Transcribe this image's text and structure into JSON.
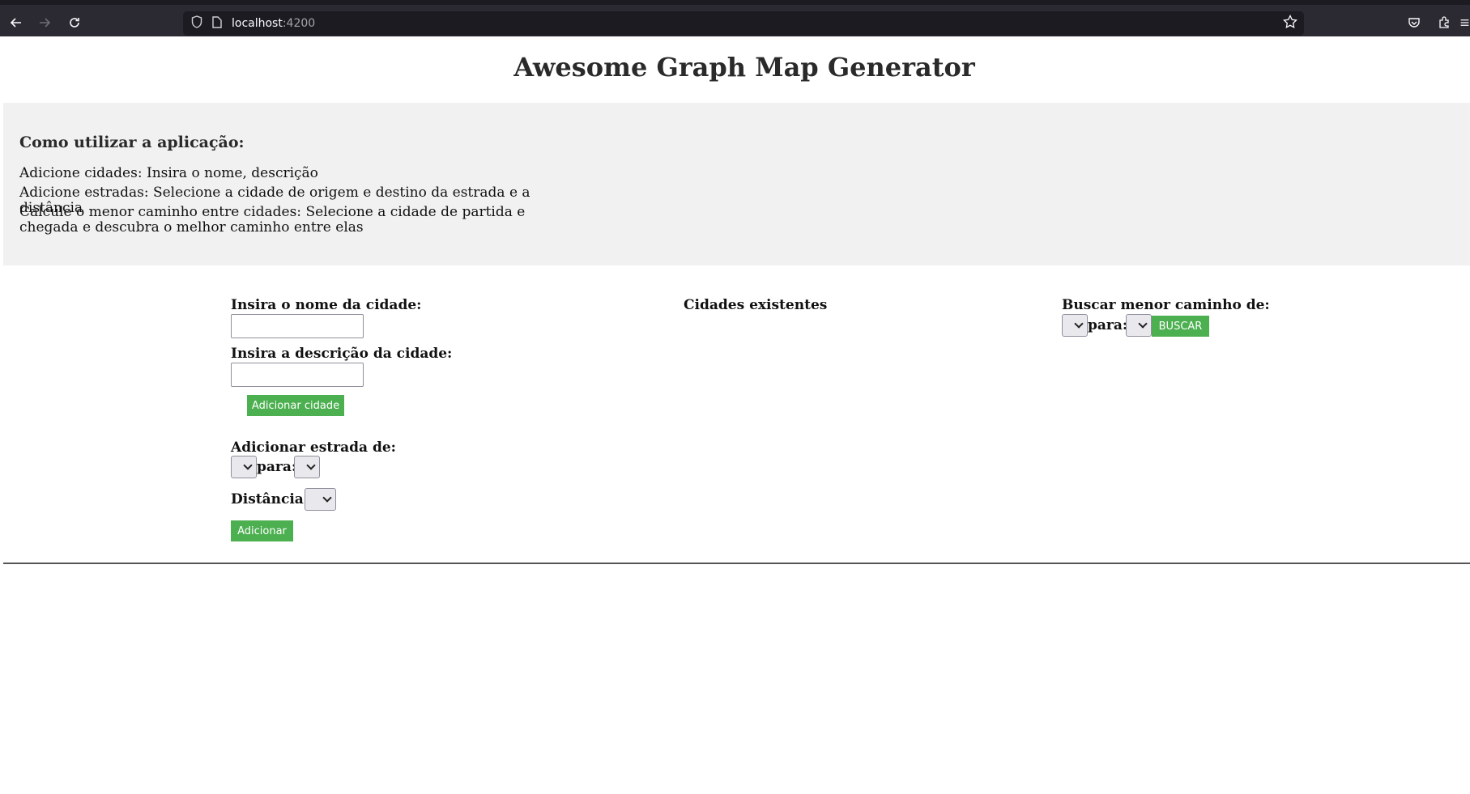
{
  "browser": {
    "url_host": "localhost",
    "url_port": ":4200",
    "icons": [
      "back-arrow-icon",
      "forward-arrow-icon",
      "reload-icon",
      "shield-icon",
      "page-icon",
      "star-icon",
      "pocket-icon",
      "extensions-icon",
      "menu-icon"
    ]
  },
  "page": {
    "title": "Awesome Graph Map Generator"
  },
  "instructions": {
    "heading": "Como utilizar a aplicação:",
    "items": [
      "Adicione cidades: Insira o nome, descrição",
      "Adicione estradas: Selecione a cidade de origem e destino da estrada e a distância",
      "Calcule o menor caminho entre cidades: Selecione a cidade de partida e chegada e descubra o melhor caminho entre elas"
    ]
  },
  "city_form": {
    "name_label": "Insira o nome da cidade:",
    "name_value": "",
    "description_label": "Insira a descrição da cidade:",
    "description_value": "",
    "add_button": "Adicionar cidade"
  },
  "road_form": {
    "from_label": "Adicionar estrada de:",
    "to_label": "para:",
    "distance_label": "Distância:",
    "from_value": "",
    "to_value": "",
    "distance_value": "",
    "add_button": "Adicionar"
  },
  "cities": {
    "heading": "Cidades existentes",
    "items": []
  },
  "shortest_path": {
    "from_label": "Buscar menor caminho de:",
    "to_label": "para:",
    "from_value": "",
    "to_value": "",
    "search_button": "BUSCAR"
  },
  "colors": {
    "button_green": "#4caf50",
    "instructions_bg": "#f1f1f1",
    "chrome_bg": "#2b2a33"
  }
}
